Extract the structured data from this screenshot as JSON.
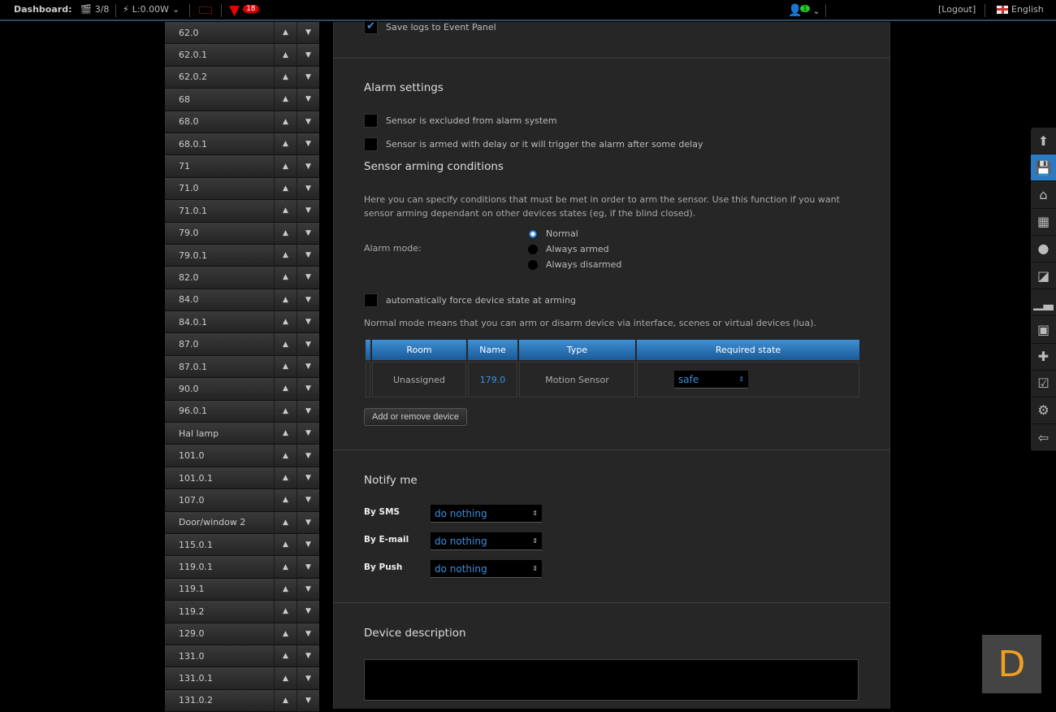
{
  "topbar": {
    "dashboard": "Dashboard:",
    "scenes": "3/8",
    "power": "L:0.00W",
    "alerts": "18",
    "users_badge": "1",
    "logout": "[Logout]",
    "language": "English"
  },
  "devices": [
    "62.0",
    "62.0.1",
    "62.0.2",
    "68",
    "68.0",
    "68.0.1",
    "71",
    "71.0",
    "71.0.1",
    "79.0",
    "79.0.1",
    "82.0",
    "84.0",
    "84.0.1",
    "87.0",
    "87.0.1",
    "90.0",
    "96.0.1",
    "Hal lamp",
    "101.0",
    "101.0.1",
    "107.0",
    "Door/window 2",
    "115.0.1",
    "119.0.1",
    "119.1",
    "119.2",
    "129.0",
    "131.0",
    "131.0.1",
    "131.0.2"
  ],
  "main": {
    "save_logs": "Save logs to Event Panel",
    "alarm_title": "Alarm settings",
    "excluded": "Sensor is excluded from alarm system",
    "armed_delay": "Sensor is armed with delay or it will trigger the alarm after some delay",
    "arming_title": "Sensor arming conditions",
    "arming_desc": "Here you can specify conditions that must be met in order to arm the sensor. Use this function if you want sensor arming dependant on other devices states (eg, if the blind closed).",
    "alarm_mode_label": "Alarm mode:",
    "modes": [
      "Normal",
      "Always armed",
      "Always disarmed"
    ],
    "force_state": "automatically force device state at arming",
    "normal_desc": "Normal mode means that you can arm or disarm device via interface, scenes or virtual devices (lua).",
    "table": {
      "headers": [
        "Room",
        "Name",
        "Type",
        "Required state"
      ],
      "rows": [
        {
          "room": "Unassigned",
          "name": "179.0",
          "type": "Motion Sensor",
          "state": "safe"
        }
      ]
    },
    "add_remove": "Add or remove device",
    "notify_title": "Notify me",
    "notify": [
      {
        "label": "By SMS",
        "value": "do nothing"
      },
      {
        "label": "By E-mail",
        "value": "do nothing"
      },
      {
        "label": "By Push",
        "value": "do nothing"
      }
    ],
    "desc_title": "Device description"
  },
  "sidebar_icons": [
    "arrow-up",
    "save",
    "home",
    "rooms",
    "bulb",
    "scenes",
    "chart",
    "gift",
    "plugins",
    "panels",
    "settings",
    "exit"
  ],
  "logo_letter": "D"
}
